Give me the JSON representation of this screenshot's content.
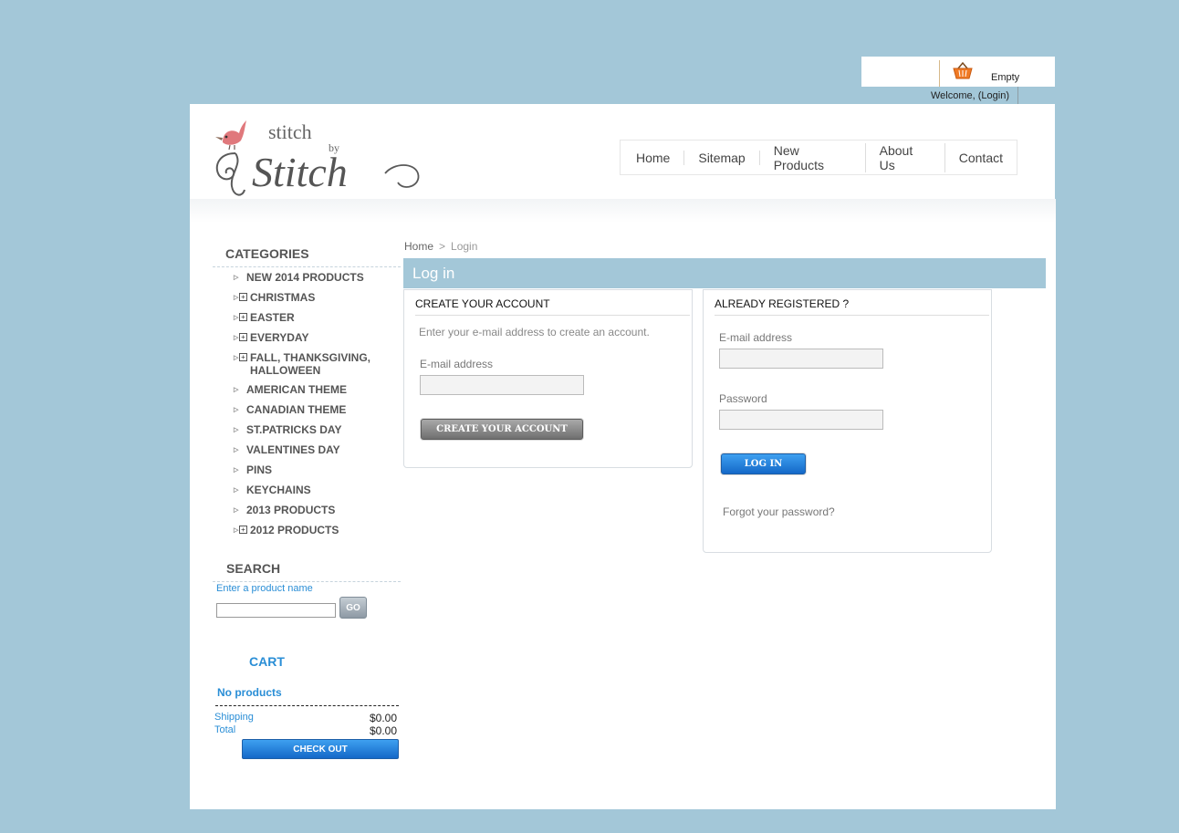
{
  "topbar": {
    "cart_status": "Empty",
    "welcome": "Welcome, (Login)"
  },
  "header": {
    "logo_icon": "stitch-by-stitch-logo",
    "nav": [
      "Home",
      "Sitemap",
      "New Products",
      "About Us",
      "Contact"
    ]
  },
  "sidebar": {
    "categories_title": "CATEGORIES",
    "categories": [
      {
        "label": "NEW 2014 PRODUCTS",
        "expandable": false
      },
      {
        "label": "CHRISTMAS",
        "expandable": true
      },
      {
        "label": "EASTER",
        "expandable": true
      },
      {
        "label": "EVERYDAY",
        "expandable": true
      },
      {
        "label": "FALL, THANKSGIVING, HALLOWEEN",
        "expandable": true
      },
      {
        "label": "AMERICAN THEME",
        "expandable": false
      },
      {
        "label": "CANADIAN THEME",
        "expandable": false
      },
      {
        "label": "ST.PATRICKS DAY",
        "expandable": false
      },
      {
        "label": "VALENTINES DAY",
        "expandable": false
      },
      {
        "label": "PINS",
        "expandable": false
      },
      {
        "label": "KEYCHAINS",
        "expandable": false
      },
      {
        "label": "2013 PRODUCTS",
        "expandable": false
      },
      {
        "label": "2012 PRODUCTS",
        "expandable": true
      }
    ],
    "search_title": "SEARCH",
    "search_hint": "Enter a product name",
    "search_value": "",
    "go_label": "GO",
    "cart_title": "CART",
    "cart_empty": "No products",
    "shipping_label": "Shipping",
    "shipping_value": "$0.00",
    "total_label": "Total",
    "total_value": "$0.00",
    "checkout_label": "CHECK OUT"
  },
  "main": {
    "breadcrumb_home": "Home",
    "breadcrumb_sep": ">",
    "breadcrumb_current": "Login",
    "page_title": "Log in",
    "create": {
      "title": "CREATE YOUR ACCOUNT",
      "hint": "Enter your e-mail address to create an account.",
      "email_label": "E-mail address",
      "email_value": "",
      "button": "CREATE YOUR ACCOUNT"
    },
    "login": {
      "title": "ALREADY REGISTERED ?",
      "email_label": "E-mail address",
      "email_value": "",
      "password_label": "Password",
      "password_value": "",
      "button": "LOG IN",
      "forgot": "Forgot your password?"
    }
  },
  "colors": {
    "page_bg": "#a3c7d8",
    "accent_blue": "#2a8ed6",
    "title_bar": "#a3c7d8"
  }
}
